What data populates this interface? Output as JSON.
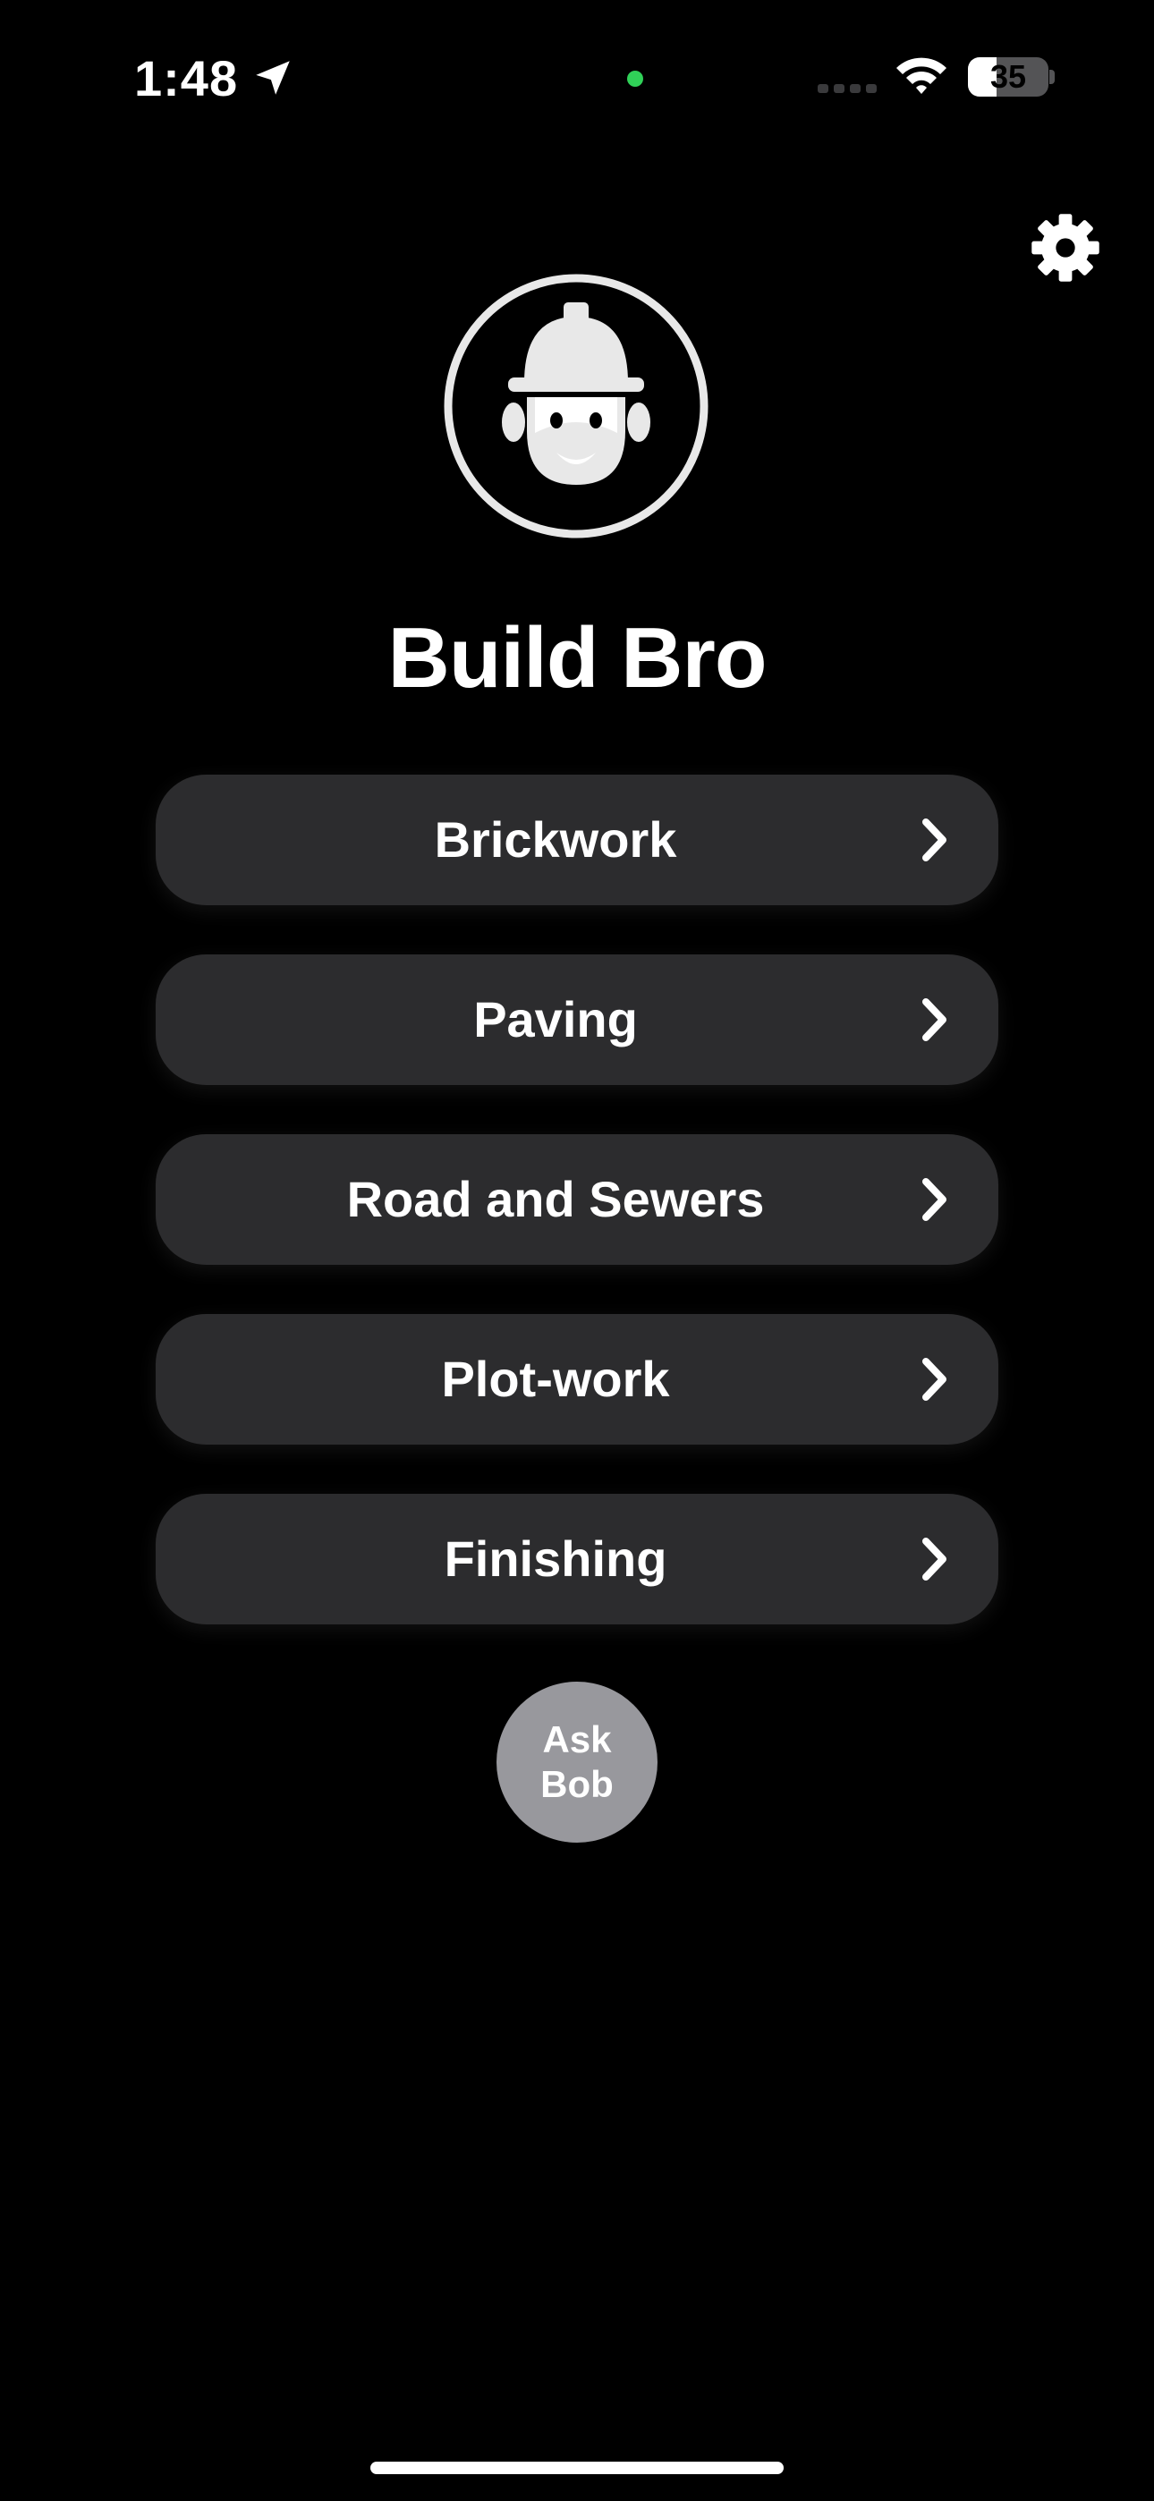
{
  "status_bar": {
    "time": "1:48",
    "battery_level": "35",
    "location_icon": "location-arrow-icon",
    "wifi_icon": "wifi-icon",
    "camera_indicator_color": "#30d158"
  },
  "header": {
    "settings_icon": "gear-icon",
    "logo_icon": "construction-worker-icon",
    "title": "Build Bro"
  },
  "menu": {
    "items": [
      {
        "label": "Brickwork"
      },
      {
        "label": "Paving"
      },
      {
        "label": "Road and Sewers"
      },
      {
        "label": "Plot-work"
      },
      {
        "label": "Finishing"
      }
    ],
    "chevron_icon": "chevron-right-icon",
    "button_color": "#2c2c2e"
  },
  "ask_bob": {
    "label": "Ask\nBob",
    "color": "#98989d"
  }
}
